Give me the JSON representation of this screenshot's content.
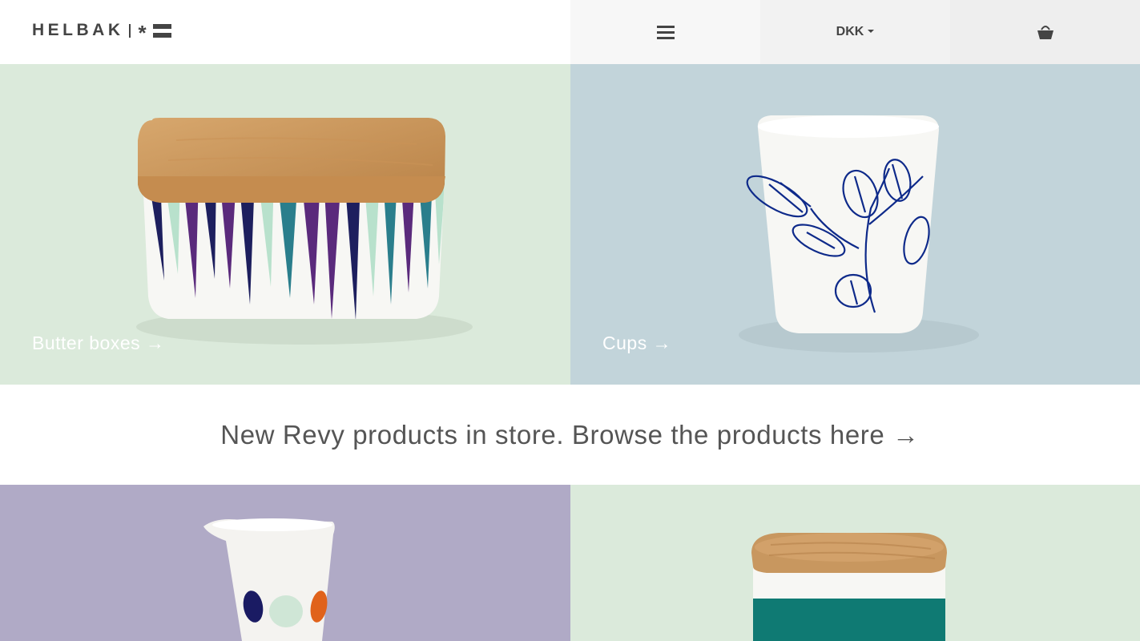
{
  "header": {
    "logo": {
      "wordmark": "HELBAK",
      "symbol": "*",
      "label": "HELBAK"
    },
    "menu_icon": "hamburger-icon",
    "currency": "DKK",
    "cart_icon": "basket-icon"
  },
  "tiles": [
    {
      "label": "Butter boxes →",
      "background": "#dbeadb"
    },
    {
      "label": "Cups →",
      "background": "#c2d4da"
    },
    {
      "label": "",
      "background": "#b0aac6"
    },
    {
      "label": "",
      "background": "#dbeadb"
    }
  ],
  "promo": {
    "text": "New Revy products in store. Browse the products here →"
  }
}
